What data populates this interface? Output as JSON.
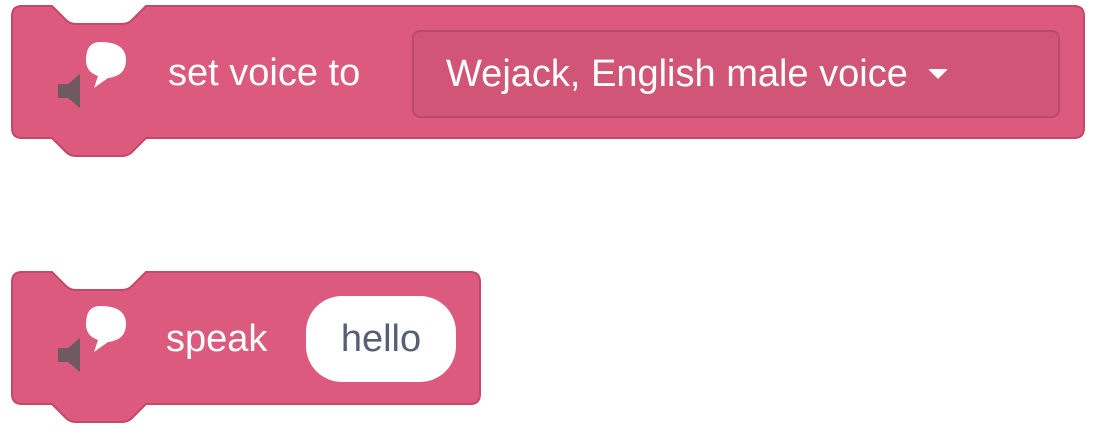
{
  "colors": {
    "block_fill": "#dc5a7e",
    "block_stroke": "#c4486c",
    "text": "#ffffff",
    "pill_text": "#575e75"
  },
  "blocks": [
    {
      "icon": "text-to-speech-icon",
      "label": "set voice to",
      "dropdown_value": "Wejack, English male voice"
    },
    {
      "icon": "text-to-speech-icon",
      "label": "speak",
      "input_value": "hello"
    }
  ]
}
